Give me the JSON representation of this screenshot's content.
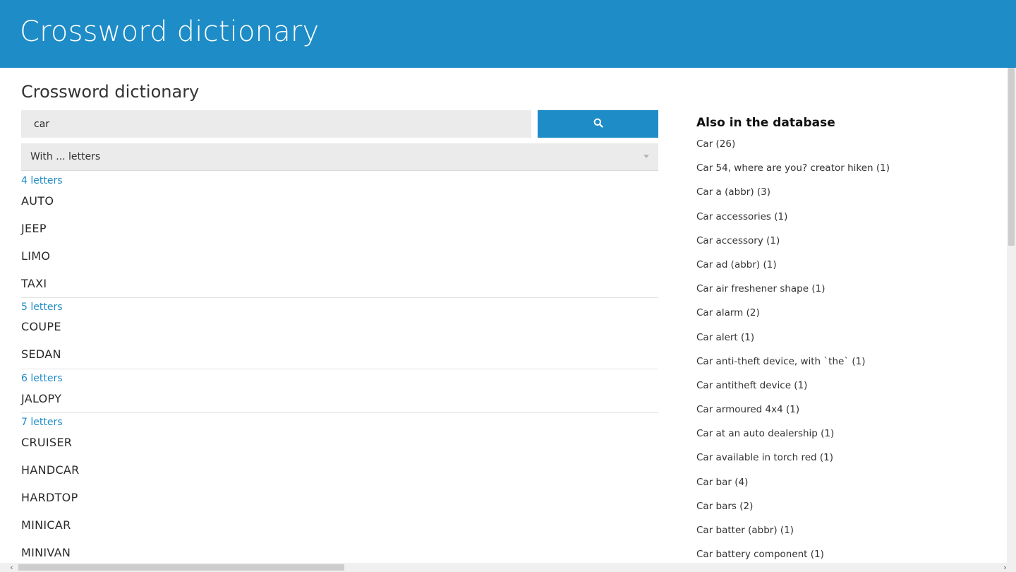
{
  "header": {
    "app_title": "Crossword dictionary"
  },
  "main": {
    "page_title": "Crossword dictionary",
    "search": {
      "value": "car",
      "button_icon": "search-icon"
    },
    "filter": {
      "selected": "With ... letters"
    },
    "groups": [
      {
        "label": "4 letters",
        "answers": [
          "AUTO",
          "JEEP",
          "LIMO",
          "TAXI"
        ]
      },
      {
        "label": "5 letters",
        "answers": [
          "COUPE",
          "SEDAN"
        ]
      },
      {
        "label": "6 letters",
        "answers": [
          "JALOPY"
        ]
      },
      {
        "label": "7 letters",
        "answers": [
          "CRUISER",
          "HANDCAR",
          "HARDTOP",
          "MINICAR",
          "MINIVAN"
        ]
      }
    ]
  },
  "sidebar": {
    "title": "Also in the database",
    "items": [
      "Car (26)",
      "Car 54, where are you? creator hiken (1)",
      "Car a (abbr) (3)",
      "Car accessories (1)",
      "Car accessory (1)",
      "Car ad (abbr) (1)",
      "Car air freshener shape (1)",
      "Car alarm (2)",
      "Car alert (1)",
      "Car anti-theft device, with `the` (1)",
      "Car antitheft device (1)",
      "Car armoured 4x4 (1)",
      "Car at an auto dealership (1)",
      "Car available in torch red (1)",
      "Car bar (4)",
      "Car bars (2)",
      "Car batter (abbr) (1)",
      "Car battery component (1)"
    ]
  },
  "colors": {
    "accent": "#1e8cc6",
    "input_bg": "#ebebeb"
  }
}
